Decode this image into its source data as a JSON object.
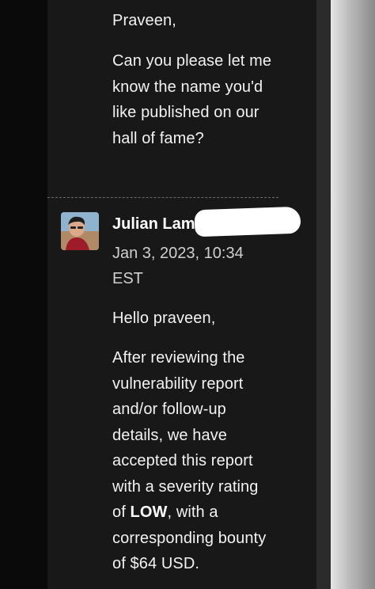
{
  "message1": {
    "greeting": "Praveen,",
    "body_lines": [
      "Can you please let me",
      "know the name you'd",
      "like published on our",
      "hall of fame?"
    ]
  },
  "message2": {
    "sender_name": "Julian Lam",
    "date_line1": "Jan 3, 2023, 10:34",
    "date_line2": "EST",
    "greeting": "Hello praveen,",
    "body": {
      "line1": "After reviewing the",
      "line2": "vulnerability report",
      "line3": "and/or follow-up",
      "line4": "details, we have",
      "line5": "accepted this report",
      "line6": "with a severity rating",
      "line7_prefix": "of ",
      "line7_bold": "LOW",
      "line7_suffix": ", with a",
      "line8": "corresponding bounty",
      "line9": "of $64 USD."
    }
  }
}
